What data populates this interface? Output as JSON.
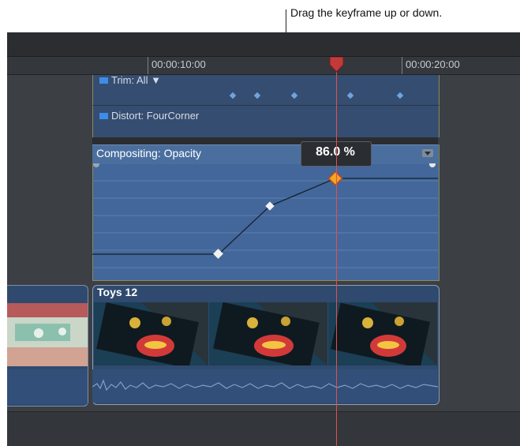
{
  "callout": {
    "text": "Drag the keyframe up or down."
  },
  "ruler": {
    "time_a": "00:00:10:00",
    "time_b": "00:00:20:00"
  },
  "effects": {
    "trim_label": "Trim: All ▼",
    "distort_label": "Distort: FourCorner"
  },
  "opacity": {
    "title": "Compositing: Opacity",
    "value": "86.0 %"
  },
  "clip": {
    "name": "Toys 12"
  },
  "colors": {
    "playhead": "#e05050",
    "selected_keyframe": "#f5a623",
    "effect_row": "#354d70",
    "opacity_panel": "#43679a"
  }
}
